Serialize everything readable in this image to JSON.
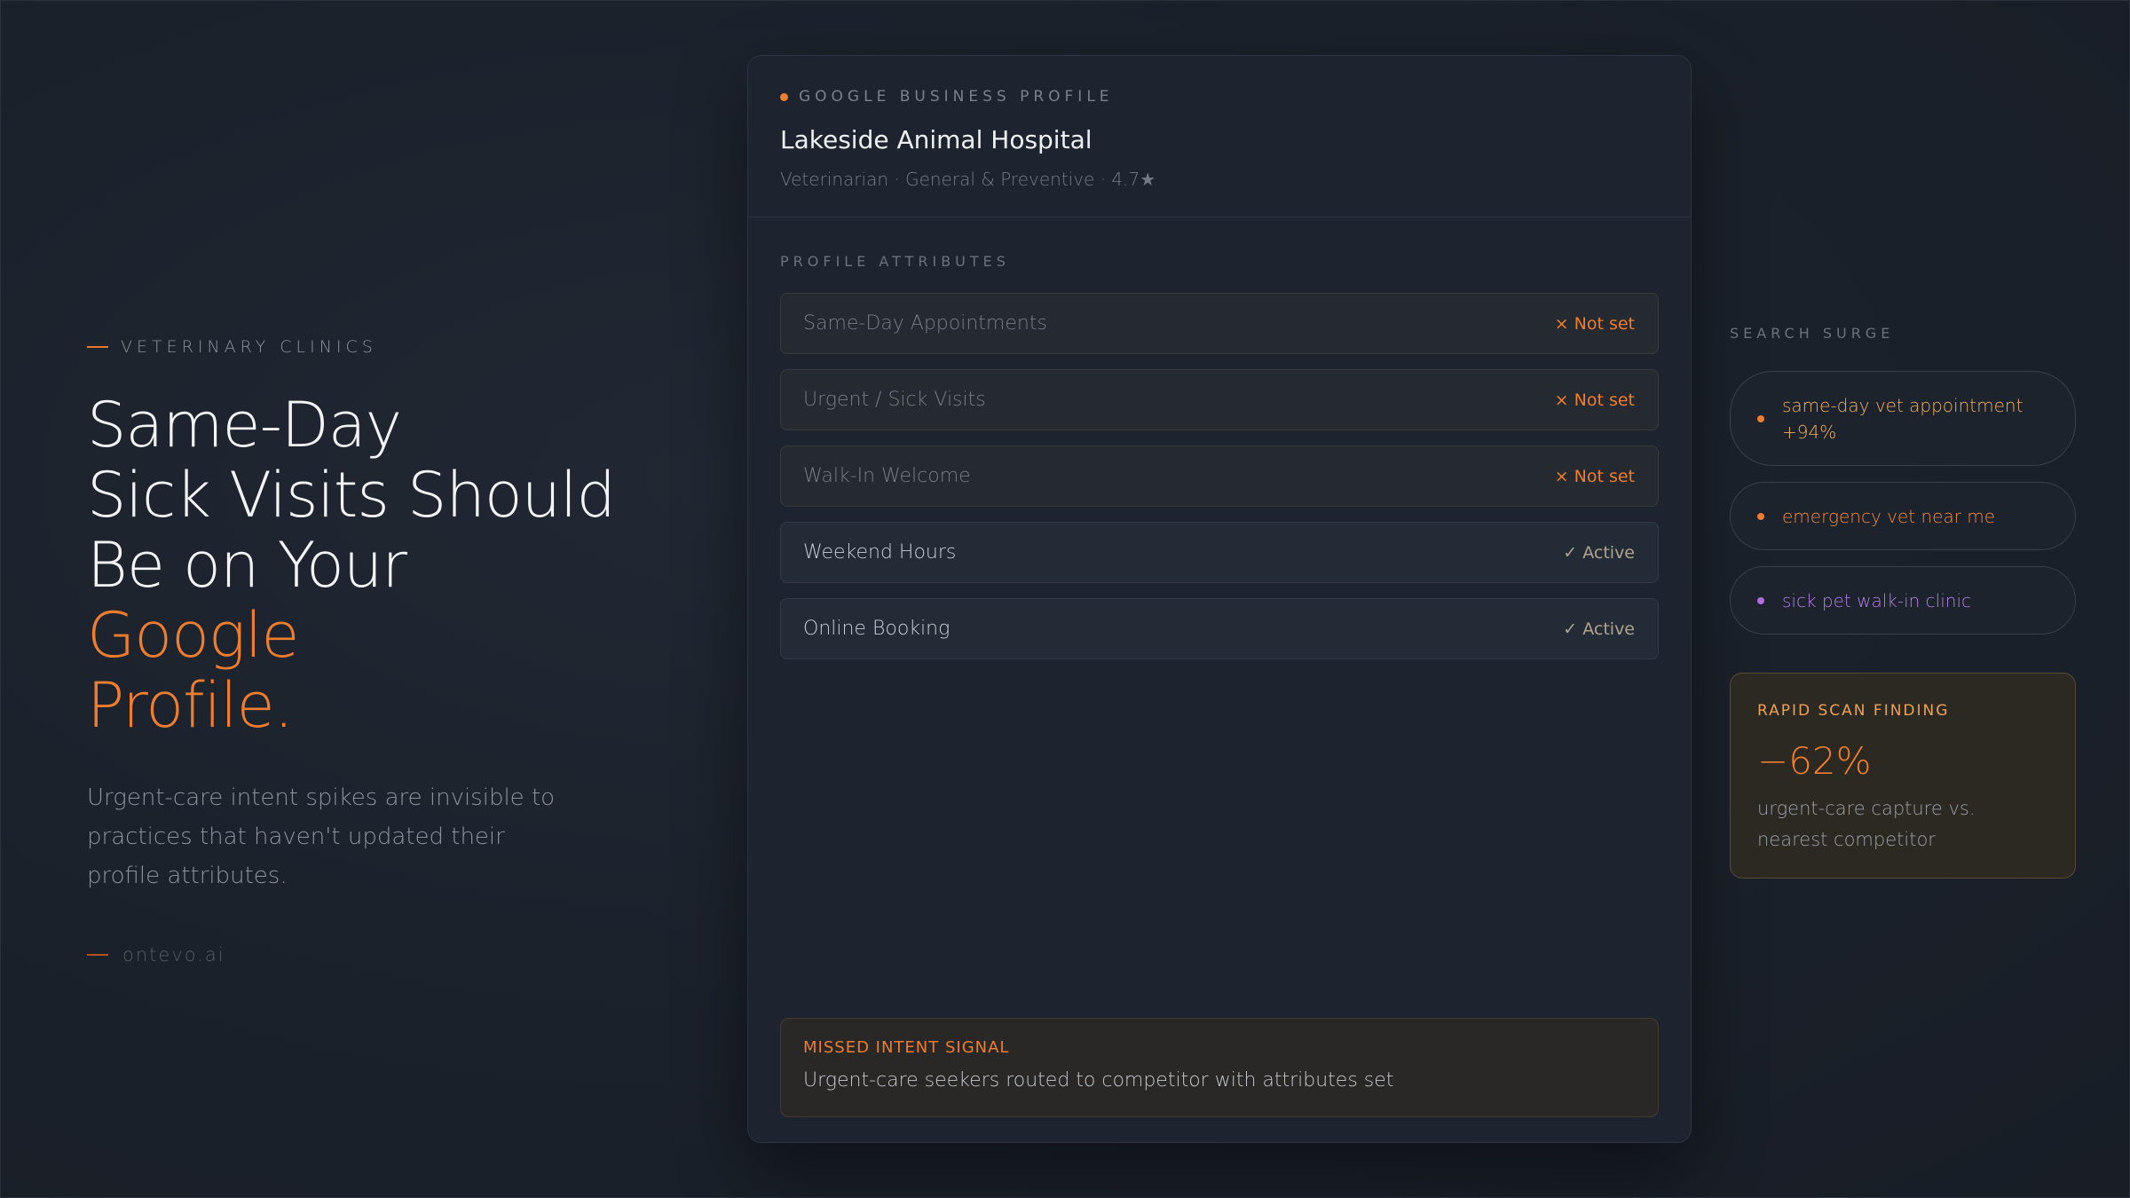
{
  "hero": {
    "eyebrow": "VETERINARY CLINICS",
    "headline_lines": [
      "Same-Day",
      "Sick Visits Should",
      "Be on Your"
    ],
    "headline_accent_lines": [
      "Google",
      "Profile."
    ],
    "body": "Urgent-care intent spikes are invisible to practices that haven't updated their profile attributes.",
    "brand": "ontevo.ai"
  },
  "profile_card": {
    "label": "GOOGLE BUSINESS PROFILE",
    "business_name": "Lakeside Animal Hospital",
    "business_meta": "Veterinarian · General & Preventive · 4.7★",
    "attributes_label": "PROFILE ATTRIBUTES",
    "attributes": [
      {
        "name": "Same-Day Appointments",
        "status": "× Not set",
        "state": "unset"
      },
      {
        "name": "Urgent / Sick Visits",
        "status": "× Not set",
        "state": "unset"
      },
      {
        "name": "Walk-In Welcome",
        "status": "× Not set",
        "state": "unset"
      },
      {
        "name": "Weekend Hours",
        "status": "✓ Active",
        "state": "active"
      },
      {
        "name": "Online Booking",
        "status": "✓ Active",
        "state": "active"
      }
    ],
    "missed_signal": {
      "title": "MISSED INTENT SIGNAL",
      "body": "Urgent-care seekers routed to competitor with attributes set"
    }
  },
  "search_surge": {
    "label": "SEARCH SURGE",
    "pills": [
      {
        "line1": "same-day vet appointment",
        "line2": "+94%",
        "color": "#ef7d2e"
      },
      {
        "line1": "emergency vet near me",
        "color": "#ef7d2e"
      },
      {
        "line1": "sick pet walk-in clinic",
        "color": "#b36ce0"
      }
    ]
  },
  "finding": {
    "title": "RAPID SCAN FINDING",
    "value": "−62%",
    "description": "urgent-care capture vs. nearest competitor"
  },
  "colors": {
    "accent": "#ef7d2e",
    "purple": "#b36ce0",
    "background": "#1b212b"
  }
}
